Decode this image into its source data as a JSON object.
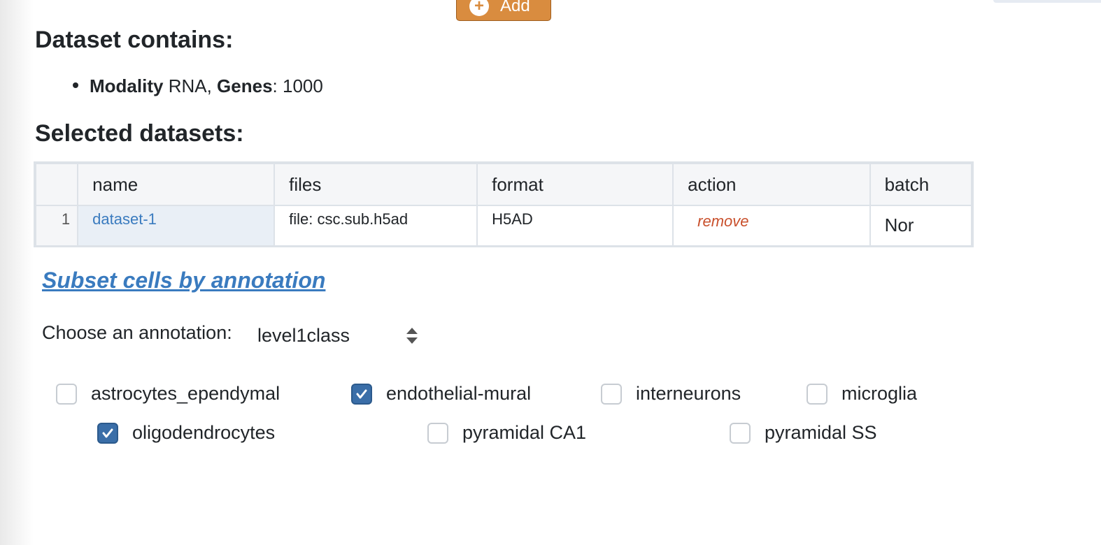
{
  "toolbar": {
    "add_label": "Add"
  },
  "headings": {
    "contains": "Dataset contains:",
    "selected": "Selected datasets:"
  },
  "contains": {
    "modality_label": "Modality",
    "modality_value": "RNA,",
    "genes_label": "Genes",
    "genes_value": ": 1000"
  },
  "table": {
    "columns": [
      "name",
      "files",
      "format",
      "action",
      "batch"
    ],
    "rows": [
      {
        "index": "1",
        "name": "dataset-1",
        "files": "file: csc.sub.h5ad",
        "format": "H5AD",
        "action": "remove",
        "batch": "Nor"
      }
    ]
  },
  "subset_link": "Subset cells by annotation",
  "annotation": {
    "label": "Choose an annotation:",
    "selected": "level1class"
  },
  "checkboxes": [
    {
      "label": "astrocytes_ependymal",
      "checked": false
    },
    {
      "label": "endothelial-mural",
      "checked": true
    },
    {
      "label": "interneurons",
      "checked": false
    },
    {
      "label": "microglia",
      "checked": false
    },
    {
      "label": "oligodendrocytes",
      "checked": true
    },
    {
      "label": "pyramidal CA1",
      "checked": false
    },
    {
      "label": "pyramidal SS",
      "checked": false
    }
  ],
  "colors": {
    "accent": "#3a7bbf",
    "add_button": "#d98c3f",
    "remove": "#c9502c",
    "checkbox_checked": "#3a6ea8"
  }
}
